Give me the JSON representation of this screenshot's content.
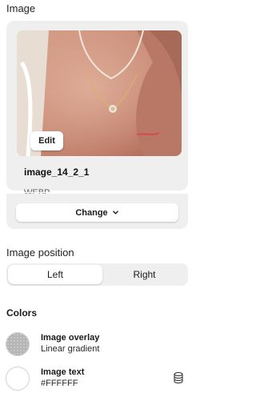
{
  "image_section": {
    "label": "Image",
    "edit_label": "Edit",
    "file_name": "image_14_2_1",
    "file_type": "WEBP",
    "change_label": "Change",
    "change_icon": "chevron-down-icon"
  },
  "image_position": {
    "label": "Image position",
    "options": [
      "Left",
      "Right"
    ],
    "selected": "Left"
  },
  "colors": {
    "title": "Colors",
    "items": [
      {
        "name": "Image overlay",
        "value": "Linear gradient",
        "swatch": "#b5b5b5"
      },
      {
        "name": "Image text",
        "value": "#FFFFFF",
        "swatch": "#FFFFFF",
        "icon": "database-icon"
      }
    ]
  }
}
